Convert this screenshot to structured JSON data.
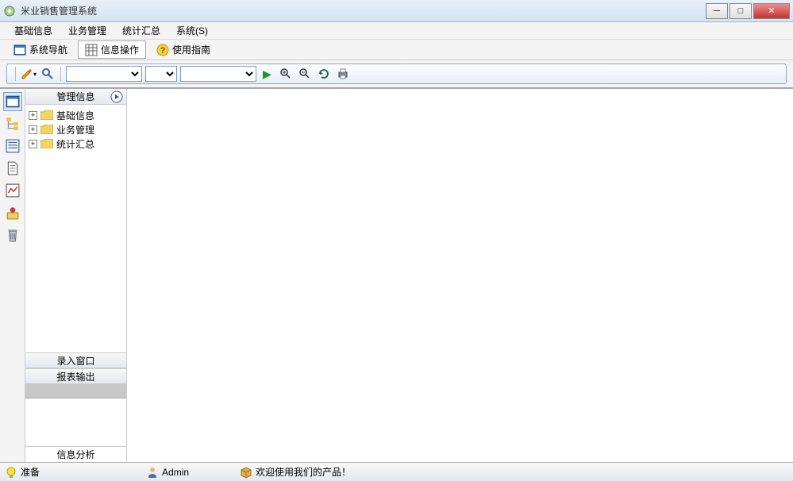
{
  "window": {
    "title": "米业销售管理系统"
  },
  "menus": {
    "basic": "基础信息",
    "business": "业务管理",
    "stats": "统计汇总",
    "system": "系统(S)"
  },
  "subtabs": {
    "nav": "系统导航",
    "info": "信息操作",
    "guide": "使用指南"
  },
  "sidepanel": {
    "header": "管理信息",
    "tree": {
      "n1": "基础信息",
      "n2": "业务管理",
      "n3": "统计汇总"
    },
    "sect1": "录入窗口",
    "sect2": "报表输出",
    "footer": "信息分析"
  },
  "status": {
    "ready": "准备",
    "user": "Admin",
    "welcome": "欢迎使用我们的产品！"
  }
}
